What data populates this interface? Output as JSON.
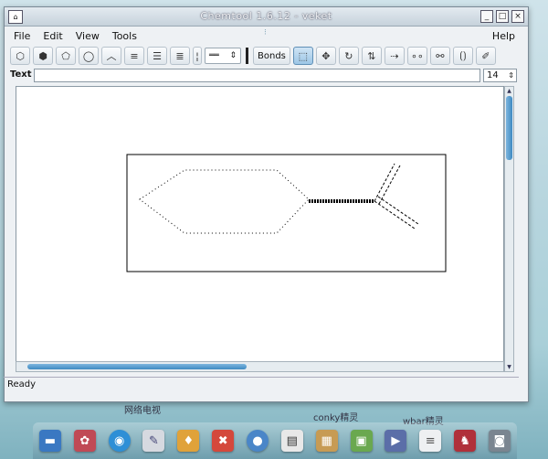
{
  "window": {
    "title": "Chemtool 1.6.12 - veket",
    "controls": [
      "minimize-icon",
      "maximize-icon",
      "close-icon"
    ]
  },
  "menu": {
    "items": [
      "File",
      "Edit",
      "View",
      "Tools"
    ],
    "help": "Help"
  },
  "toolbar": {
    "bonds_label": "Bonds",
    "bond_style_icon": "double-line-icon",
    "tools": [
      "hexagon-flat-icon",
      "hexagon-icon",
      "pentagon-icon",
      "circle-ring-icon",
      "chain-icon",
      "align-left-icon",
      "align-center-icon",
      "align-right-icon"
    ],
    "edit_tools": [
      "select-icon",
      "move-icon",
      "rotate-icon",
      "flip-icon",
      "arrow-icon",
      "atoms-icon",
      "link-icon",
      "bracket-icon",
      "erase-icon"
    ]
  },
  "text_row": {
    "label": "Text :",
    "value": "",
    "font_size": "14"
  },
  "status": {
    "text": "Ready"
  },
  "desktop": {
    "labels": [
      "网络电视",
      "conky精灵",
      "wbar精灵"
    ]
  },
  "dock": {
    "icons": [
      "folder-icon",
      "photo-icon",
      "browser-icon",
      "paint-icon",
      "torch-icon",
      "tools-icon",
      "disk-icon",
      "document-icon",
      "package-icon",
      "image-viewer-icon",
      "media-player-icon",
      "notes-icon",
      "chess-icon",
      "camera-icon"
    ]
  }
}
